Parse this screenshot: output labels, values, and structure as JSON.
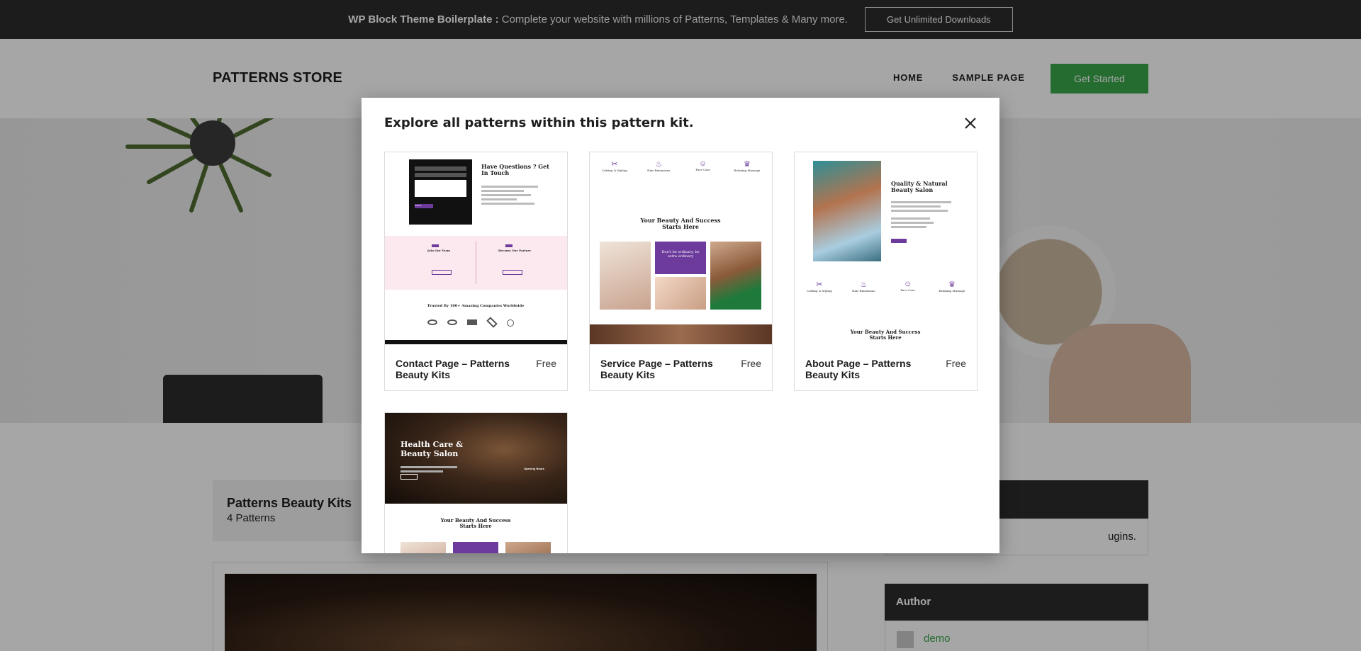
{
  "promo": {
    "brand": "WP Block Theme Boilerplate :",
    "message": " Complete your website with millions of Patterns, Templates & Many more.",
    "button": "Get Unlimited Downloads"
  },
  "header": {
    "logo": "PATTERNS STORE",
    "nav": [
      "HOME",
      "SAMPLE PAGE"
    ],
    "cta": "Get Started"
  },
  "content": {
    "kit_title": "Patterns Beauty Kits",
    "kit_count": "4 Patterns",
    "side_text": "ugins.",
    "author_heading": "Author",
    "author_name": "demo"
  },
  "modal": {
    "title": "Explore all patterns within this pattern kit.",
    "cards": [
      {
        "name": "Contact Page – Patterns Beauty Kits",
        "price": "Free",
        "thumb": {
          "heading": "Have Questions ? Get In Touch",
          "button": "Submit",
          "col_left": "Join Our Team",
          "col_right": "Become Our Partner",
          "trusted": "Trusted By 100+ Amazing Companies Worldwide"
        }
      },
      {
        "name": "Service Page – Patterns Beauty Kits",
        "price": "Free",
        "thumb": {
          "services": [
            "Cutting & Styling",
            "Hair Extensions",
            "Face Care",
            "Relaxing Massage"
          ],
          "heading": "Your Beauty And Success Starts Here",
          "promo": "Don't be ordinary, be extra ordinary"
        }
      },
      {
        "name": "About Page – Patterns Beauty Kits",
        "price": "Free",
        "thumb": {
          "heading": "Quality & Natural Beauty Salon",
          "services": [
            "Cutting & Styling",
            "Hair Extensions",
            "Face Care",
            "Relaxing Massage"
          ],
          "footer_heading": "Your Beauty And Success Starts Here"
        }
      },
      {
        "name": "",
        "price": "",
        "thumb": {
          "heading": "Health Care & Beauty Salon",
          "opening": "Opening Hours",
          "footer_heading": "Your Beauty And Success Starts Here"
        }
      }
    ]
  },
  "colors": {
    "promo_bg": "#2b2b2b",
    "cta_green": "#3aa74a",
    "accent_purple": "#6c3b9c",
    "overlay": "rgba(0,0,0,0.35)"
  }
}
